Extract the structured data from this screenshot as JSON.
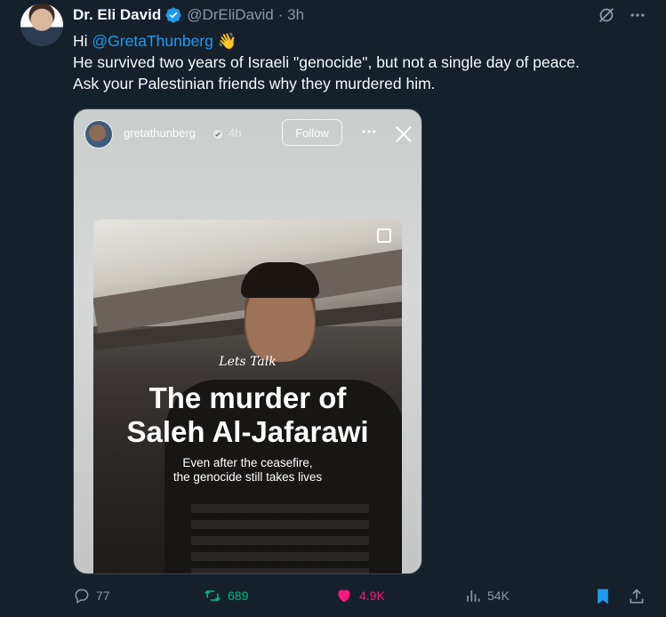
{
  "tweet": {
    "author_name": "Dr. Eli David",
    "handle": "@DrEliDavid",
    "time": "· 3h",
    "greeting": "Hi",
    "mention": "@GretaThunberg",
    "emoji": "👋",
    "line1": "He survived two years of Israeli \"genocide\", but not a single day of peace.",
    "line2": "Ask your Palestinian friends why they murdered him."
  },
  "embed": {
    "username": "gretathunberg",
    "time": "4h",
    "follow_label": "Follow",
    "script_text": "Lets Talk",
    "title_line1": "The murder of",
    "title_line2": "Saleh Al-Jafarawi",
    "sub_line1": "Even after the ceasefire,",
    "sub_line2": "the genocide still takes lives"
  },
  "actions": {
    "replies": "77",
    "retweets": "689",
    "likes": "4.9K",
    "views": "54K"
  },
  "colors": {
    "background": "#15202b",
    "accent": "#1d9bf0",
    "retweet": "#00ba7c",
    "like": "#f91880",
    "muted": "#8b98a5"
  },
  "icons": [
    "verified-badge-icon",
    "grok-icon",
    "more-icon",
    "reply-icon",
    "retweet-icon",
    "heart-icon",
    "views-icon",
    "bookmark-icon",
    "share-icon",
    "close-icon"
  ]
}
